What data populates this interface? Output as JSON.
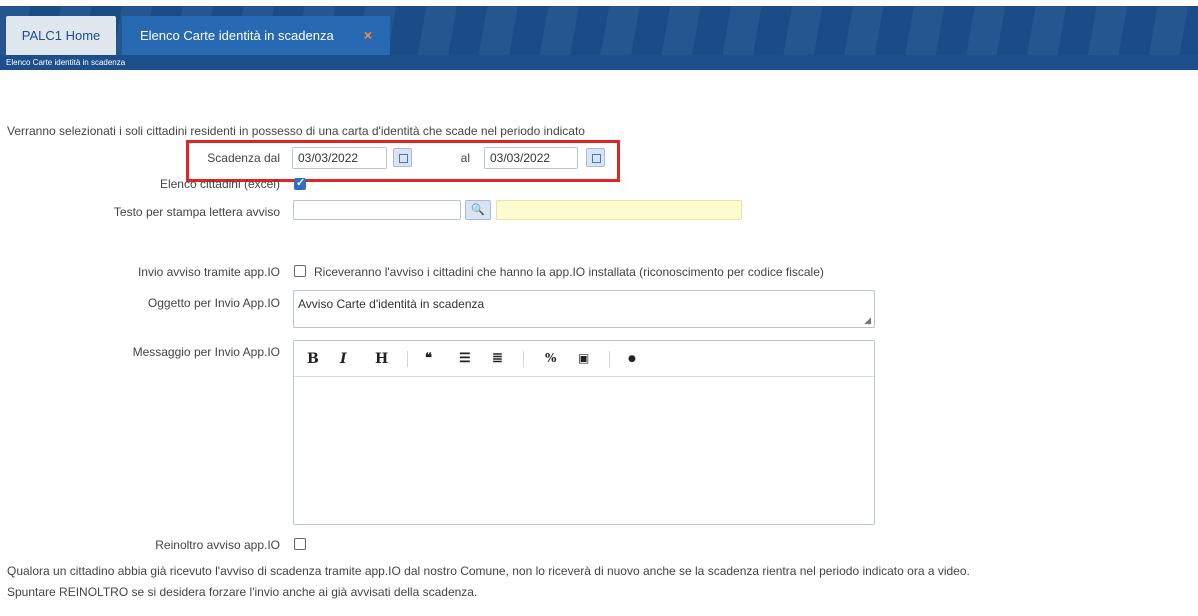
{
  "tabs": {
    "home_label": "PALC1 Home",
    "active_label": "Elenco Carte identità in scadenza",
    "close_glyph": "×"
  },
  "subbar": {
    "text": "Elenco Carte identità in scadenza"
  },
  "form": {
    "intro": "Verranno selezionati i soli cittadini residenti in possesso di una carta d'identità che scade nel periodo indicato",
    "scadenza_dal_label": "Scadenza dal",
    "scadenza_dal_value": "03/03/2022",
    "al_label": "al",
    "al_value": "03/03/2022",
    "elenco_label": "Elenco cittadini (excel)",
    "elenco_checked": true,
    "testo_label": "Testo per stampa lettera avviso",
    "testo_value": "",
    "invio_label": "Invio avviso tramite app.IO",
    "invio_desc": "Riceveranno l'avviso i cittadini che hanno la app.IO installata (riconoscimento per codice fiscale)",
    "oggetto_label": "Oggetto per Invio App.IO",
    "oggetto_value": "Avviso Carte d'identità in scadenza",
    "messaggio_label": "Messaggio per Invio App.IO",
    "toolbar": {
      "bold": "B",
      "italic": "I",
      "heading": "H",
      "quote": "❝",
      "ul": "☰",
      "ol": "≣",
      "link": "%",
      "image": "▣",
      "preview": "●"
    },
    "reinoltro_label": "Reinoltro avviso app.IO",
    "note1": "Qualora un cittadino abbia già ricevuto l'avviso di scadenza tramite app.IO dal nostro Comune, non lo riceverà di nuovo anche se la scadenza rientra nel periodo indicato ora a video.",
    "note2": "Spuntare REINOLTRO se si desidera forzare l'invio anche ai già avvisati della scadenza."
  },
  "colors": {
    "header": "#1c4f8c",
    "active_tab": "#2769b3",
    "highlight": "#e02424"
  }
}
